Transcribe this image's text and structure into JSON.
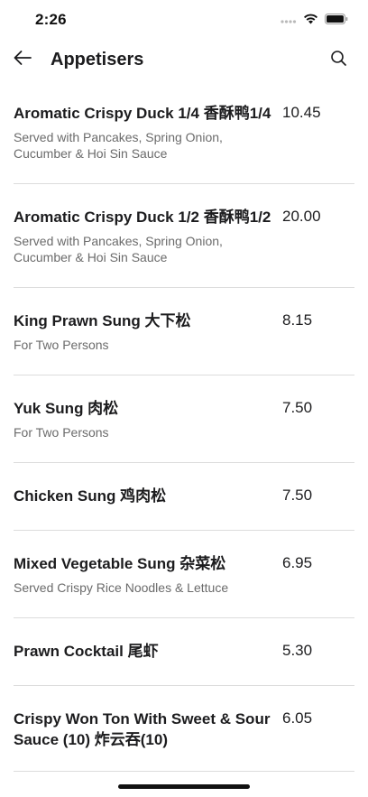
{
  "status_bar": {
    "time": "2:26",
    "icons": [
      "signal-icon",
      "wifi-icon",
      "battery-icon"
    ]
  },
  "header": {
    "title": "Appetisers",
    "back_icon": "arrow-left-icon",
    "search_icon": "search-icon"
  },
  "colors": {
    "text_primary": "#1c1c1e",
    "text_secondary": "#6b6b6b",
    "divider": "#dcdcdc",
    "background": "#ffffff"
  },
  "items": [
    {
      "name": "Aromatic Crispy Duck 1/4 香酥鸭1/4",
      "price": "10.45",
      "description": "Served with Pancakes, Spring Onion, Cucumber & Hoi Sin Sauce"
    },
    {
      "name": "Aromatic Crispy Duck 1/2 香酥鸭1/2",
      "price": "20.00",
      "description": "Served with Pancakes, Spring Onion, Cucumber & Hoi Sin Sauce"
    },
    {
      "name": "King Prawn Sung 大下松",
      "price": "8.15",
      "description": "For Two Persons"
    },
    {
      "name": "Yuk Sung 肉松",
      "price": "7.50",
      "description": "For Two Persons"
    },
    {
      "name": "Chicken Sung 鸡肉松",
      "price": "7.50",
      "description": ""
    },
    {
      "name": "Mixed Vegetable Sung 杂菜松",
      "price": "6.95",
      "description": "Served Crispy Rice Noodles & Lettuce"
    },
    {
      "name": "Prawn Cocktail 尾虾",
      "price": "5.30",
      "description": ""
    },
    {
      "name": "Crispy Won Ton With Sweet & Sour Sauce (10) 炸云吞(10)",
      "price": "6.05",
      "description": ""
    }
  ]
}
